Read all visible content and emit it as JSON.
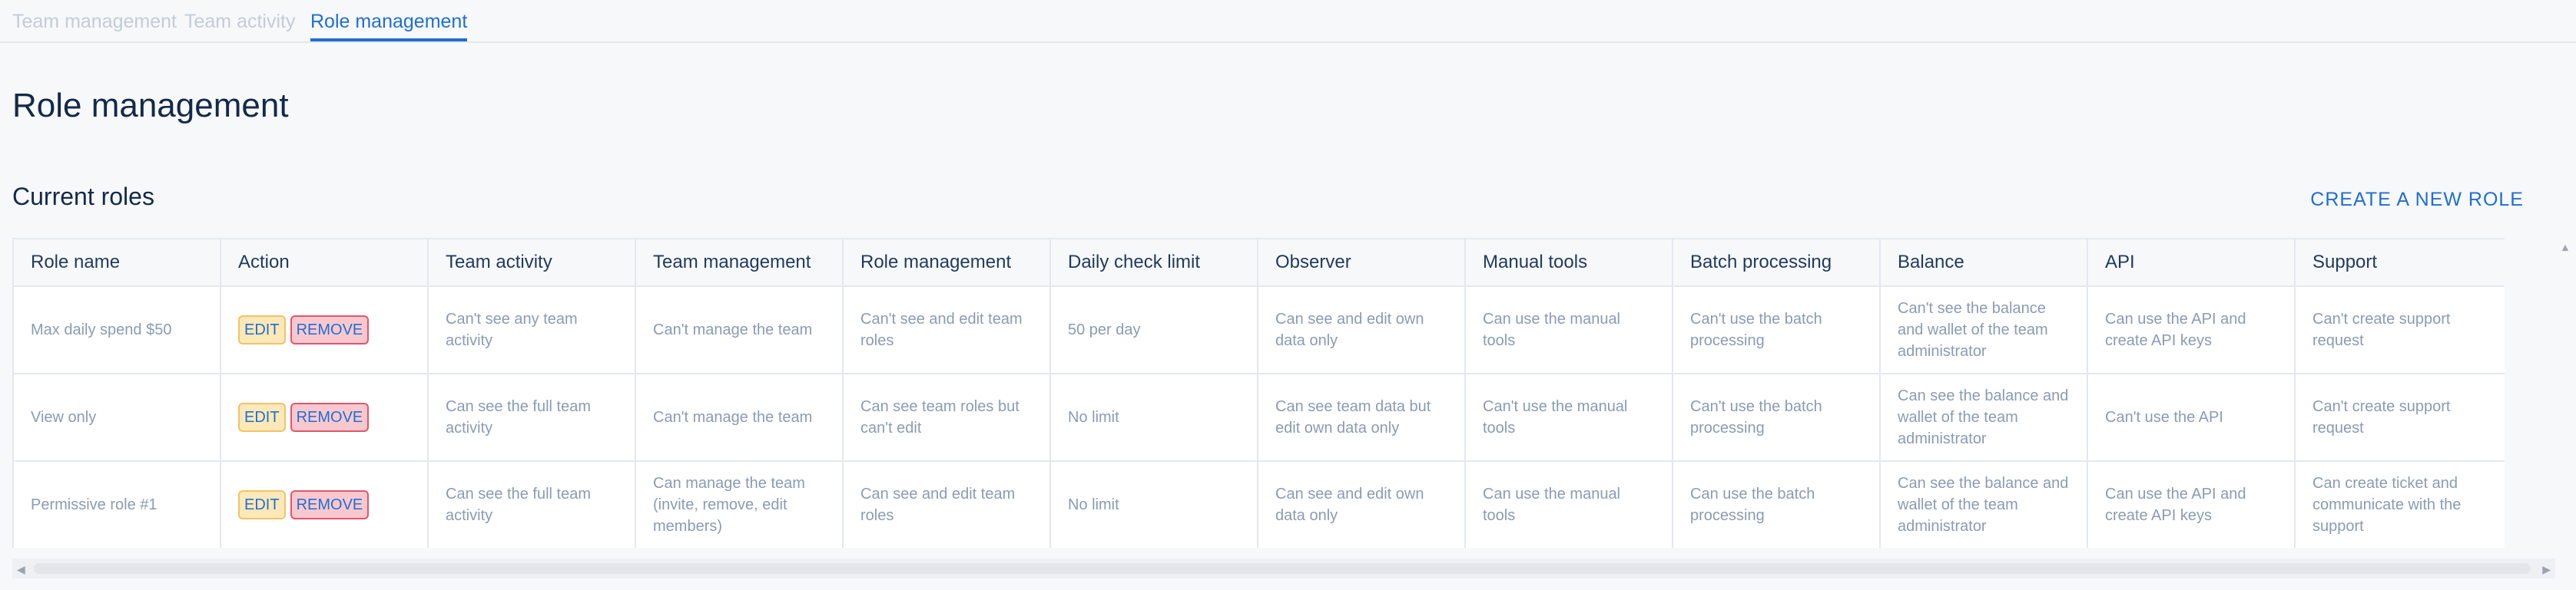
{
  "tabs": [
    {
      "label": "Team management"
    },
    {
      "label": "Team activity"
    },
    {
      "label": "Role management"
    }
  ],
  "page_title": "Role management",
  "section_title": "Current roles",
  "create_role_label": "CREATE A NEW ROLE",
  "table": {
    "headers": [
      "Role name",
      "Action",
      "Team activity",
      "Team management",
      "Role management",
      "Daily check limit",
      "Observer",
      "Manual tools",
      "Batch processing",
      "Balance",
      "API",
      "Support"
    ],
    "edit_label": "EDIT",
    "remove_label": "REMOVE",
    "rows": [
      {
        "name": "Max daily spend $50",
        "cells": [
          "Can't see any team activity",
          "Can't manage the team",
          "Can't see and edit team roles",
          "50 per day",
          "Can see and edit own data only",
          "Can use the manual tools",
          "Can't use the batch processing",
          "Can't see the balance and wallet of the team administrator",
          "Can use the API and create API keys",
          "Can't create support request"
        ]
      },
      {
        "name": "View only",
        "cells": [
          "Can see the full team activity",
          "Can't manage the team",
          "Can see team roles but can't edit",
          "No limit",
          "Can see team data but edit own data only",
          "Can't use the manual tools",
          "Can't use the batch processing",
          "Can see the balance and wallet of the team administrator",
          "Can't use the API",
          "Can't create support request"
        ]
      },
      {
        "name": "Permissive role #1",
        "cells": [
          "Can see the full team activity",
          "Can manage the team (invite, remove, edit members)",
          "Can see and edit team roles",
          "No limit",
          "Can see and edit own data only",
          "Can use the manual tools",
          "Can use the batch processing",
          "Can see the balance and wallet of the team administrator",
          "Can use the API and create API keys",
          "Can create ticket and communicate with the support"
        ]
      }
    ]
  },
  "colors": {
    "accent": "#1f6fd0",
    "title": "#13294a",
    "muted_text": "#8a9bb4",
    "edit_bg": "#fde8b8",
    "remove_bg": "#f9c8cf"
  }
}
